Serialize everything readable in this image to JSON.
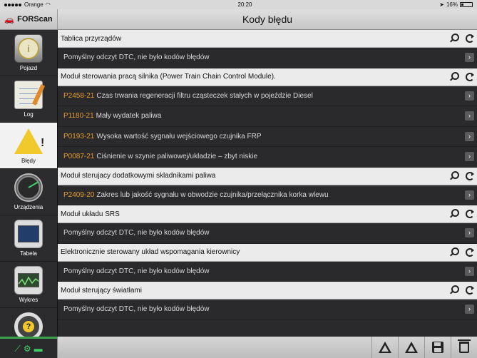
{
  "status_bar": {
    "carrier": "Orange",
    "time": "20:20",
    "battery": "16%"
  },
  "app": {
    "title": "FORScan"
  },
  "page": {
    "title": "Kody błędu"
  },
  "sidebar": {
    "items": [
      {
        "label": "Pojazd",
        "icon": "gauge-icon"
      },
      {
        "label": "Log",
        "icon": "notepad-icon"
      },
      {
        "label": "Błędy",
        "icon": "warning-icon",
        "active": true
      },
      {
        "label": "Urządzenia",
        "icon": "meter-icon"
      },
      {
        "label": "Tabela",
        "icon": "table-icon"
      },
      {
        "label": "Wykres",
        "icon": "chart-icon"
      },
      {
        "label": "",
        "icon": "steering-wheel-icon"
      }
    ]
  },
  "sections": [
    {
      "title": "Tablica przyrządów",
      "rows": [
        {
          "code": "",
          "text": "Pomyślny odczyt DTC, nie było kodów błędów"
        }
      ]
    },
    {
      "title": "Moduł sterowania pracą silnika (Power Train Chain Control Module).",
      "rows": [
        {
          "code": "P2458-21",
          "text": "Czas trwania regeneracji filtru cząsteczek stałych w pojeździe Diesel"
        },
        {
          "code": "P1180-21",
          "text": "Mały wydatek paliwa"
        },
        {
          "code": "P0193-21",
          "text": "Wysoka wartość sygnału wejściowego czujnika FRP"
        },
        {
          "code": "P0087-21",
          "text": "Ciśnienie w szynie paliwowej/układzie – zbyt niskie"
        }
      ]
    },
    {
      "title": "Moduł sterujacy dodatkowymi skladnikami paliwa",
      "rows": [
        {
          "code": "P2409-20",
          "text": "Zakres lub jakość sygnału w obwodzie czujnika/przełącznika korka wlewu"
        }
      ]
    },
    {
      "title": "Moduł układu SRS",
      "rows": [
        {
          "code": "",
          "text": "Pomyślny odczyt DTC, nie było kodów błędów"
        }
      ]
    },
    {
      "title": "Elektronicznie sterowany układ wspomagania kierownicy",
      "rows": [
        {
          "code": "",
          "text": "Pomyślny odczyt DTC, nie było kodów błędów"
        }
      ]
    },
    {
      "title": "Moduł sterujący światłami",
      "rows": [
        {
          "code": "",
          "text": "Pomyślny odczyt DTC, nie było kodów błędów"
        }
      ]
    }
  ],
  "toolbar": {
    "buttons": [
      "warning-read-icon",
      "warning-clear-icon",
      "save-icon",
      "trash-icon"
    ]
  },
  "colors": {
    "code": "#e39a2c",
    "connected": "#3aa24a"
  }
}
